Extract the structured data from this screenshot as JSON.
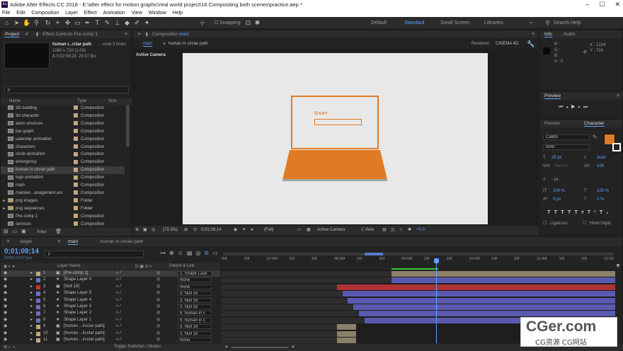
{
  "app": {
    "title": "Adobe After Effects CC 2018 - E:\\after effect for motion graphic\\real world project\\16 Compositing both scenes\\practice.aep *",
    "logo": "Ae"
  },
  "window_controls": {
    "minimize": "–",
    "maximize": "☐",
    "close": "✕"
  },
  "menu": [
    "File",
    "Edit",
    "Composition",
    "Layer",
    "Effect",
    "Animation",
    "View",
    "Window",
    "Help"
  ],
  "toolbar": {
    "snapping": "Snapping",
    "workspaces": [
      "Default",
      "Standard",
      "Small Screen",
      "Libraries"
    ],
    "active_workspace": "Standard",
    "search_placeholder": "Search Help"
  },
  "project": {
    "tab": "Project",
    "effect_tab": "Effect Controls Pre-comp 1",
    "item_name": "human i...rclar path",
    "item_used": ", used 3 times",
    "item_size": "1280 x 720 (1.00)",
    "item_duration": "Δ 0;02;59;28, 29.97 fps",
    "search_placeholder": "ρ·",
    "columns": {
      "name": "Name",
      "type": "Type",
      "size": "Size"
    },
    "items": [
      {
        "name": "3D building",
        "type": "Composition"
      },
      {
        "name": "3d character",
        "type": "Composition"
      },
      {
        "name": "atom structure",
        "type": "Composition"
      },
      {
        "name": "bar graph",
        "type": "Composition"
      },
      {
        "name": "calendar animation",
        "type": "Composition"
      },
      {
        "name": "characters",
        "type": "Composition"
      },
      {
        "name": "circle animation",
        "type": "Composition"
      },
      {
        "name": "emergency",
        "type": "Composition"
      },
      {
        "name": "human in circlar path",
        "type": "Composition"
      },
      {
        "name": "logo animation",
        "type": "Composition"
      },
      {
        "name": "main",
        "type": "Composition"
      },
      {
        "name": "mainten...anagement ani",
        "type": "Composition"
      },
      {
        "name": "png images",
        "type": "Folder"
      },
      {
        "name": "png sequences",
        "type": "Folder"
      },
      {
        "name": "Pre-comp 1",
        "type": "Composition"
      },
      {
        "name": "services",
        "type": "Composition"
      }
    ],
    "bpc": "8 bpc"
  },
  "composition": {
    "tab_label": "Composition",
    "tab_name": "main",
    "breadcrumb": [
      "main",
      "human in circlar path"
    ],
    "renderer_label": "Renderer:",
    "renderer": "CINEMA 4D",
    "view_label": "Active Camera",
    "user_text": "User",
    "footer": {
      "zoom": "(73.3%)",
      "timecode": "0;01;09;14",
      "resolution": "(Full)",
      "camera": "Active Camera",
      "views": "1 View",
      "exposure": "+0.0"
    }
  },
  "info": {
    "tab": "Info",
    "audio_tab": "Audio",
    "r": "R :",
    "g": "G :",
    "b": "B :",
    "a": "A :  0",
    "x": "X : 1224",
    "y": "Y : 724"
  },
  "preview": {
    "tab": "Preview"
  },
  "character": {
    "presets_tab": "Presets",
    "tab": "Character",
    "font": "Calibri",
    "style": "Bold",
    "size": "25 px",
    "leading": "Auto",
    "kerning": "Metrics",
    "tracking": "109",
    "stroke": "- px",
    "vscale": "100 %",
    "hscale": "100 %",
    "baseline": "0 px",
    "tsume": "0 %",
    "ligatures": "Ligatures",
    "hindi_digits": "Hindi Digits",
    "fill_color": "#e07b25"
  },
  "timeline": {
    "tabs": [
      "target",
      "main",
      "human in circlar path"
    ],
    "active_tab": "main",
    "timecode": "0;01;09;14",
    "frames": "02083 (29.97 fps)",
    "search_placeholder": "ρ·",
    "layer_name_col": "Layer Name",
    "parent_col": "Parent & Link",
    "toggle_label": "Toggle Switches / Modes",
    "ruler": [
      "00f",
      "20f",
      "07:00f",
      "10f",
      "20f",
      "08:00f",
      "10f",
      "20f",
      "09:00f",
      "10f",
      "20f",
      "10:00f",
      "10f",
      "20f",
      "11:00f",
      "10f",
      "20f",
      "12:00"
    ],
    "layers": [
      {
        "num": "1",
        "name": "[Pre-comp 1]",
        "parent": "2. Shape Laye",
        "label": "#bfa87b",
        "kind": "comp"
      },
      {
        "num": "2",
        "name": "Shape Layer 6",
        "parent": "None",
        "label": "#6e6ec8",
        "kind": "shape"
      },
      {
        "num": "3",
        "name": "[Null 18]",
        "parent": "None",
        "label": "#c83232",
        "kind": "null"
      },
      {
        "num": "4",
        "name": "Shape Layer 5",
        "parent": "3. Null 18",
        "label": "#6e6ec8",
        "kind": "shape"
      },
      {
        "num": "5",
        "name": "Shape Layer 4",
        "parent": "3. Null 18",
        "label": "#6e6ec8",
        "kind": "shape"
      },
      {
        "num": "6",
        "name": "Shape Layer 3",
        "parent": "3. Null 18",
        "label": "#6e6ec8",
        "kind": "shape"
      },
      {
        "num": "7",
        "name": "Shape Layer 2",
        "parent": "9. human in c",
        "label": "#6e6ec8",
        "kind": "shape"
      },
      {
        "num": "8",
        "name": "Shape Layer 1",
        "parent": "9. human in c",
        "label": "#6e6ec8",
        "kind": "shape"
      },
      {
        "num": "9",
        "name": "[human ...ircclar path]",
        "parent": "3. Null 18",
        "label": "#bfa87b",
        "kind": "comp"
      },
      {
        "num": "10",
        "name": "[human ...ircclar path]",
        "parent": "3. Null 18",
        "label": "#bfa87b",
        "kind": "comp"
      },
      {
        "num": "11",
        "name": "[human ...ircclar path]",
        "parent": "None",
        "label": "#bfa87b",
        "kind": "comp"
      }
    ]
  },
  "watermark": {
    "main": "CGer.com",
    "sub": "CG资源 CG网站"
  }
}
